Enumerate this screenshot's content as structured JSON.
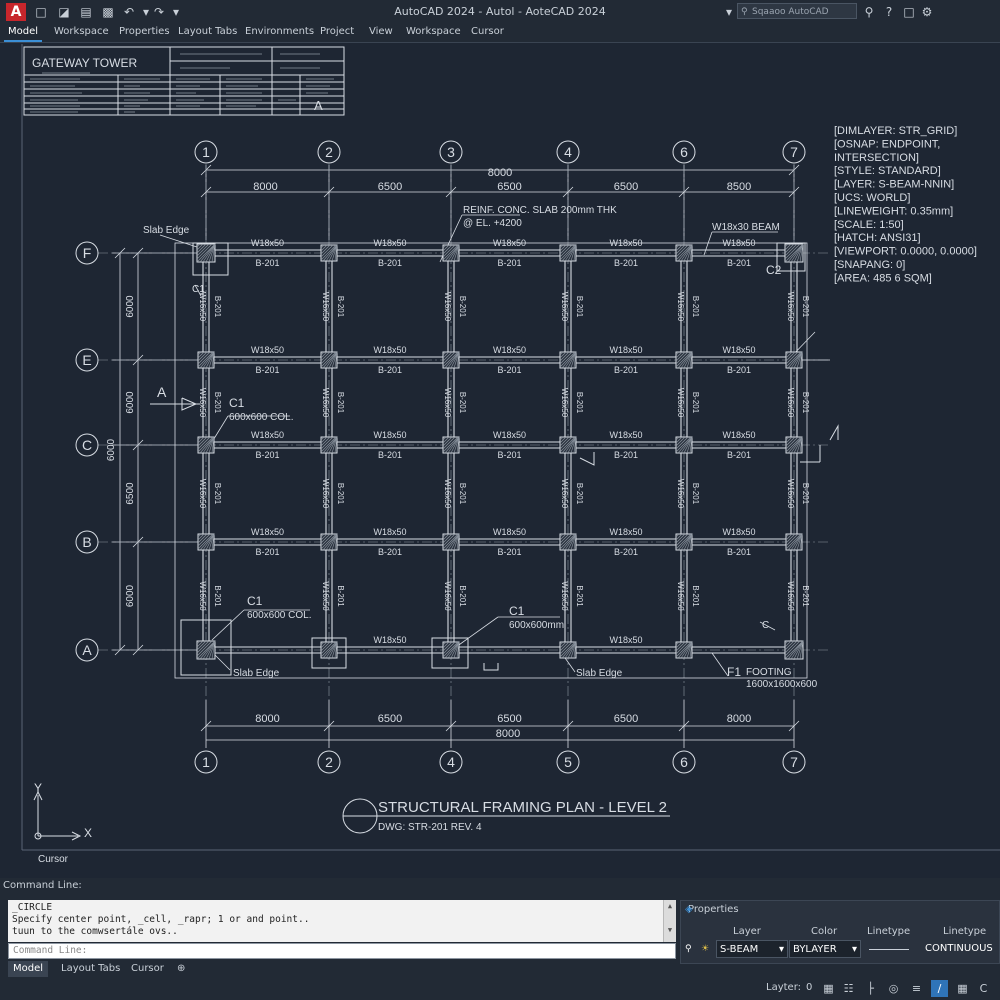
{
  "title_bar": {
    "app_logo": "A",
    "title": "AutoCAD 2024 - Autol - AoteCAD 2024",
    "search_placeholder": "Sqaaoo AutoCAD"
  },
  "menu": {
    "items": [
      "Model",
      "Workspace",
      "Properties",
      "Layout Tabs",
      "Environments",
      "Project",
      "View",
      "Workspace",
      "Cursor"
    ]
  },
  "title_block": {
    "project": "GATEWAY TOWER",
    "sheet_letter": "A"
  },
  "grid": {
    "columns": [
      "1",
      "2",
      "3",
      "4",
      "5",
      "6",
      "7"
    ],
    "rows": [
      "F",
      "E",
      "C",
      "B",
      "A"
    ],
    "column_spacings_top": [
      "8000",
      "6500",
      "6500",
      "6500",
      "8500"
    ],
    "column_spacings_bottom": [
      "8000",
      "6500",
      "6500",
      "6500",
      "8000"
    ],
    "overall_top": "8000",
    "overall_bottom": "8000",
    "row_spacings": [
      "6000",
      "6000",
      "6500",
      "6000"
    ],
    "overall_rows": "6000"
  },
  "beams": {
    "horizontal_label": "W18x50",
    "horizontal_mark": "B-201",
    "vertical_label": "W16x50",
    "vertical_mark": "B-201"
  },
  "annotations": {
    "slab_note_1": "REINF. CONC. SLAB 200mm THK",
    "slab_note_2": "@ EL. +4200",
    "beam_callout": "W18x30 BEAM",
    "slab_edge": "Slab Edge",
    "col_label_1": "C1",
    "col_note_1": "600x600 COL.",
    "col_label_2": "C1",
    "col_note_2": "600x600 COL.",
    "col_label_3": "C1",
    "col_note_3": "600x600mm",
    "corner_c": "C1",
    "corner_c2": "C2",
    "corner_small": "C",
    "footing_label": "F1",
    "footing_title": "FOOTING",
    "footing_size": "1600x1600x600",
    "section_mark": "A"
  },
  "properties_text": [
    "[DIMLAYER: STR_GRID]",
    "[OSNAP: ENDPOINT,",
    "INTERSECTION]",
    "[STYLE: STANDARD]",
    "[LAYER: S-BEAM-NNIN]",
    "[UCS: WORLD]",
    "[LINEWEIGHT: 0.35mm]",
    "[SCALE: 1:50]",
    "[HATCH: ANSI31]",
    "[VIEWPORT: 0.0000, 0.0000]",
    "[SNAPANG: 0]",
    "[AREA: 485 6 SQM]"
  ],
  "drawing_title": {
    "title": "STRUCTURAL FRAMING PLAN - LEVEL 2",
    "number": "DWG: STR-201 REV. 4"
  },
  "ucs": {
    "y": "Y",
    "x": "X"
  },
  "model_space_label": "Cursor",
  "command": {
    "label": "Command Line:",
    "history": [
      "_CIRCLE",
      "Specify center point, _cell, _rapr; 1 or and point..",
      "tuun to the comwsertále ovs.."
    ],
    "input_placeholder": "Command Line:"
  },
  "bottom_tabs": [
    "Model",
    "Layout Tabs",
    "Cursor"
  ],
  "properties_panel": {
    "title": "Properties",
    "headers": [
      "Layer",
      "Color",
      "Linetype",
      "Linetype"
    ],
    "layer": "S-BEAM",
    "color": "BYLAYER",
    "linetype": "CONTINUOUS"
  },
  "status": {
    "label": "Layter:",
    "value": "0"
  },
  "colors": {
    "background": "#1e2633",
    "line": "#d8dde4",
    "accent": "#3b8fd6",
    "logo": "#c7262c"
  }
}
